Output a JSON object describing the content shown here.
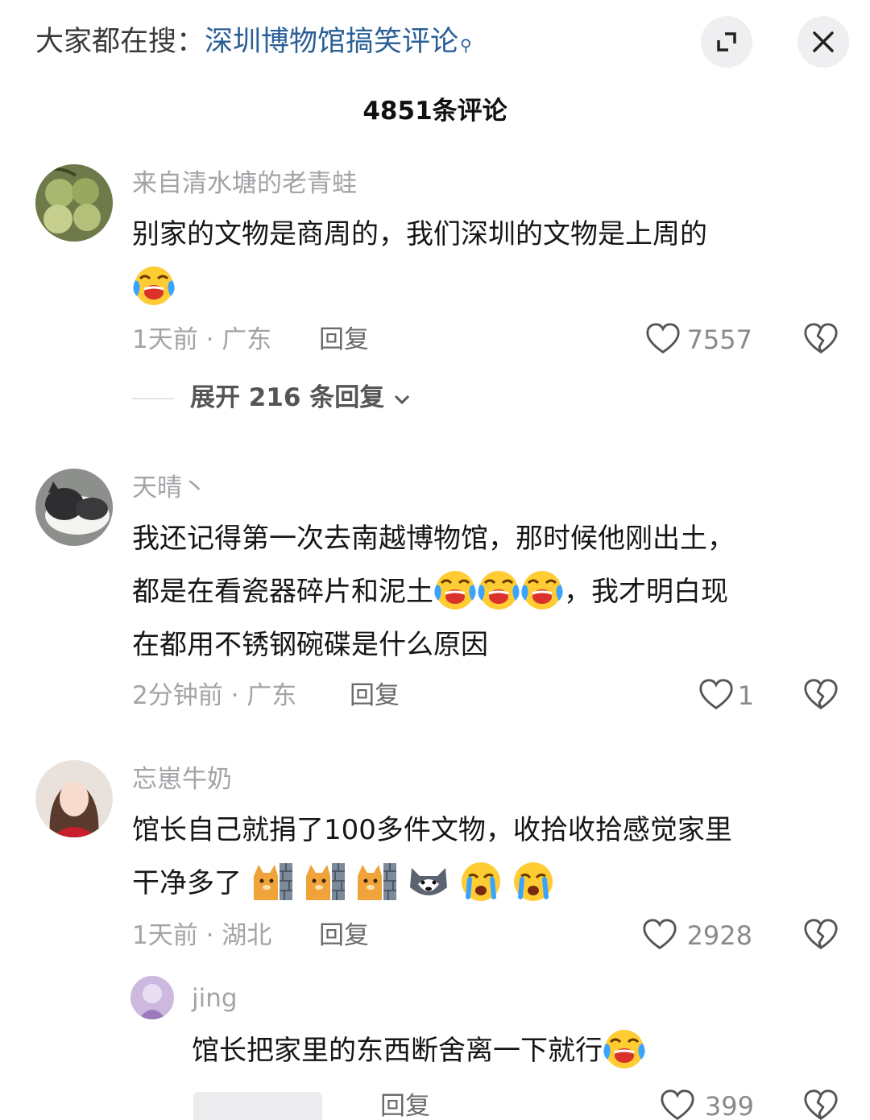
{
  "header": {
    "prefix": "大家都在搜：",
    "search_term": "深圳博物馆搞笑评论",
    "comment_count": "4851条评论"
  },
  "comments": [
    {
      "username": "来自清水塘的老青蛙",
      "text": "别家的文物是商周的，我们深圳的文物是上周的",
      "emojis": [
        "laugh-cry-emoji"
      ],
      "meta": "1天前 · 广东",
      "reply_label": "回复",
      "likes": "7557",
      "expand_label": "展开 216 条回复"
    },
    {
      "username": "天晴丶",
      "text_line1": "我还记得第一次去南越博物馆，那时候他刚出土，",
      "text_line2_a": "都是在看瓷器碎片和泥土",
      "text_line2_b": "，我才明白现",
      "text_line3": "在都用不锈钢碗碟是什么原因",
      "emojis": [
        "laugh-cry-emoji",
        "laugh-cry-emoji",
        "laugh-cry-emoji"
      ],
      "meta": "2分钟前 · 广东",
      "reply_label": "回复",
      "likes": "1"
    },
    {
      "username": "忘崽牛奶",
      "text_line1": "馆长自己就捐了100多件文物，收拾收拾感觉家里",
      "text_line2": "干净多了",
      "emojis": [
        "cat-wall-emoji",
        "cat-wall-emoji",
        "cat-wall-emoji",
        "husky-emoji",
        "sob-emoji",
        "sob-emoji"
      ],
      "meta": "1天前 · 湖北",
      "reply_label": "回复",
      "likes": "2928"
    }
  ],
  "sub_reply": {
    "username": "jing",
    "text": "馆长把家里的东西断舍离一下就行",
    "emojis": [
      "laugh-cry-emoji"
    ],
    "reply_label": "回复",
    "likes": "399"
  },
  "colors": {
    "link": "#2a5f96",
    "muted": "#a3a3a8",
    "button_bg": "#efeff1"
  }
}
